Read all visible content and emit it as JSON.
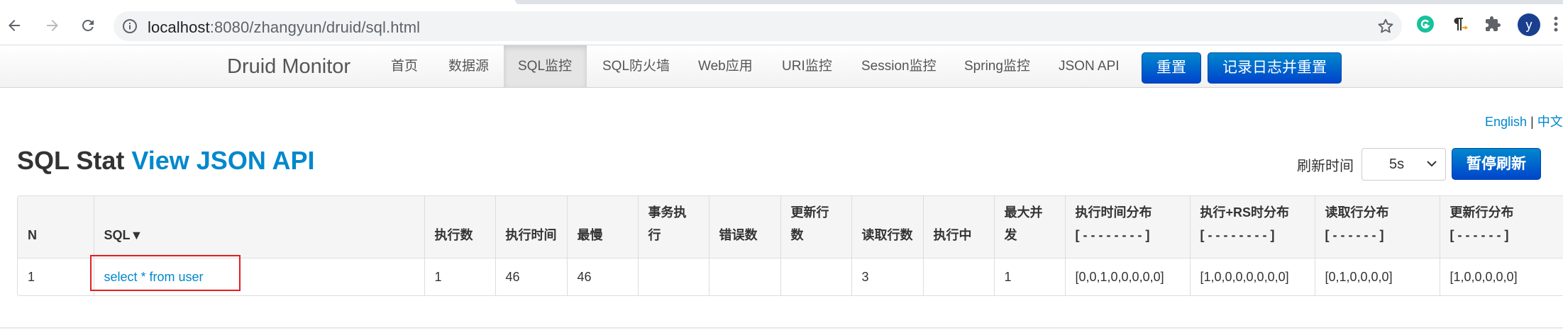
{
  "browser": {
    "url_host": "localhost",
    "url_path": ":8080/zhangyun/druid/sql.html",
    "avatar_letter": "y",
    "icons": [
      "back-arrow-icon",
      "forward-arrow-icon",
      "reload-icon",
      "info-icon",
      "star-icon",
      "grammarly-icon",
      "paragraph-icon",
      "extensions-puzzle-icon",
      "menu-dots-icon"
    ]
  },
  "navbar": {
    "brand": "Druid Monitor",
    "items": [
      {
        "label": "首页"
      },
      {
        "label": "数据源"
      },
      {
        "label": "SQL监控",
        "active": true
      },
      {
        "label": "SQL防火墙"
      },
      {
        "label": "Web应用"
      },
      {
        "label": "URI监控"
      },
      {
        "label": "Session监控"
      },
      {
        "label": "Spring监控"
      },
      {
        "label": "JSON API"
      }
    ],
    "reset_label": "重置",
    "log_reset_label": "记录日志并重置"
  },
  "lang": {
    "english": "English",
    "sep": "|",
    "chinese": "中文"
  },
  "title": {
    "main": "SQL Stat",
    "link": "View JSON API"
  },
  "refresh": {
    "label": "刷新时间",
    "value": "5s",
    "pause_label": "暂停刷新"
  },
  "table": {
    "headers": [
      {
        "line1": "N",
        "line2": ""
      },
      {
        "line1": "SQL▼",
        "line2": ""
      },
      {
        "line1": "执行数",
        "line2": ""
      },
      {
        "line1": "执行时间",
        "line2": ""
      },
      {
        "line1": "最慢",
        "line2": ""
      },
      {
        "line1": "事务执行",
        "line2": ""
      },
      {
        "line1": "错误数",
        "line2": ""
      },
      {
        "line1": "更新行数",
        "line2": ""
      },
      {
        "line1": "读取行数",
        "line2": ""
      },
      {
        "line1": "执行中",
        "line2": ""
      },
      {
        "line1": "最大并发",
        "line2": ""
      },
      {
        "line1": "执行时间分布",
        "line2": "[ - - - - - - - - ]"
      },
      {
        "line1": "执行+RS时分布",
        "line2": "[ - - - - - - - - ]"
      },
      {
        "line1": "读取行分布",
        "line2": "[ - - - - - - ]"
      },
      {
        "line1": "更新行分布",
        "line2": "[ - - - - - - ]"
      }
    ],
    "rows": [
      [
        "1",
        "select * from user",
        "1",
        "46",
        "46",
        "",
        "",
        "",
        "3",
        "",
        "1",
        "[0,0,1,0,0,0,0,0]",
        "[1,0,0,0,0,0,0,0]",
        "[0,1,0,0,0,0]",
        "[1,0,0,0,0,0]"
      ]
    ]
  },
  "colors": {
    "link": "#0088cc",
    "button_top": "#0088cc",
    "button_bottom": "#0044cc",
    "highlight_box": "#e02020"
  }
}
